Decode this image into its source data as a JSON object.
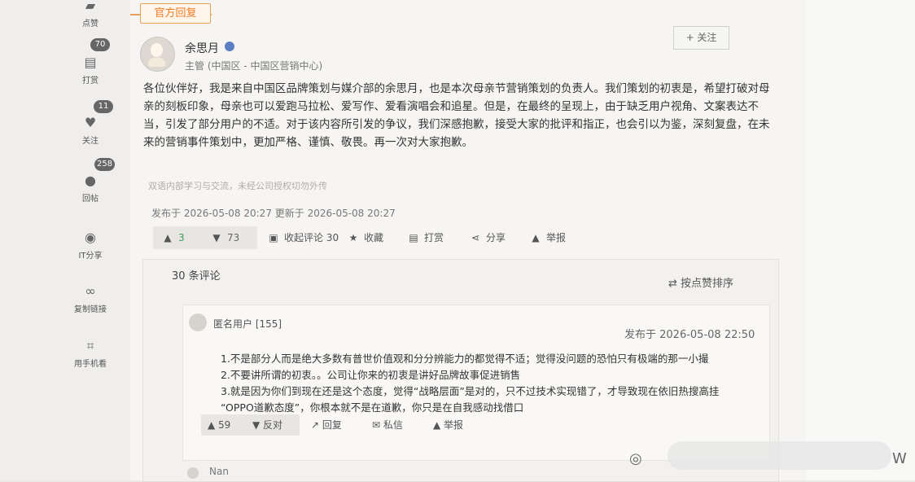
{
  "sidebar": {
    "items": [
      {
        "icon": "like-icon",
        "label": "点赞",
        "badge": "70"
      },
      {
        "icon": "coin-icon",
        "label": "打赏",
        "badge": "11"
      },
      {
        "icon": "heart-icon",
        "label": "关注",
        "badge": "258"
      },
      {
        "icon": "comment-icon",
        "label": "回帖",
        "badge": ""
      },
      {
        "icon": "share-icon",
        "label": "IT分享",
        "badge": ""
      },
      {
        "icon": "link-icon",
        "label": "复制链接",
        "badge": ""
      },
      {
        "icon": "scan-icon",
        "label": "用手机看",
        "badge": ""
      }
    ]
  },
  "post": {
    "official_tag": "官方回复",
    "author_name": "余思月",
    "author_role": "主管 (中国区 - 中国区营销中心)",
    "follow_label": "+ 关注",
    "body": "各位伙伴好，我是来自中国区品牌策划与媒介部的余思月，也是本次母亲节营销策划的负责人。我们策划的初衷是，希望打破对母亲的刻板印象，母亲也可以爱跑马拉松、爱写作、爱看演唱会和追星。但是，在最终的呈现上，由于缺乏用户视角、文案表达不当，引发了部分用户的不适。对于该内容所引发的争议，我们深感抱歉，接受大家的批评和指正，也会引以为鉴，深刻复盘，在未来的营销事件策划中，更加严格、谨慎、敬畏。再一次对大家抱歉。",
    "note": "双语内部学习与交流，未经公司授权切勿外传",
    "time": "发布于 2026-05-08 20:27 更新于 2026-05-08 20:27",
    "actions": {
      "likes": "3",
      "dislikes": "73",
      "collapse_comments": "收起评论 30",
      "favorite": "收藏",
      "tip": "打赏",
      "share": "分享",
      "report": "举报"
    }
  },
  "comments": {
    "count": "30 条评论",
    "sort_label": "按点赞排序",
    "items": [
      {
        "user": "匿名用户 [155]",
        "time": "发布于 2026-05-08 22:50",
        "lines": [
          "1.不是部分人而是绝大多数有普世价值观和分分辨能力的都觉得不适；觉得没问题的恐怕只有极端的那一小撮",
          "2.不要讲所谓的初衷。。公司让你来的初衷是讲好品牌故事促进销售",
          "3.就是因为你们到现在还是这个态度，觉得“战略层面”是对的，只不过技术实现错了，才导致现在依旧热搜高挂",
          "“OPPO道歉态度”，你根本就不是在道歉，你只是在自我感动找借口"
        ],
        "likes": "59",
        "dislike": "反对",
        "reply": "回复",
        "message": "私信",
        "report": "举报"
      }
    ],
    "next_user": "Nan"
  },
  "watermark": {
    "left": "◎",
    "right": "W"
  }
}
